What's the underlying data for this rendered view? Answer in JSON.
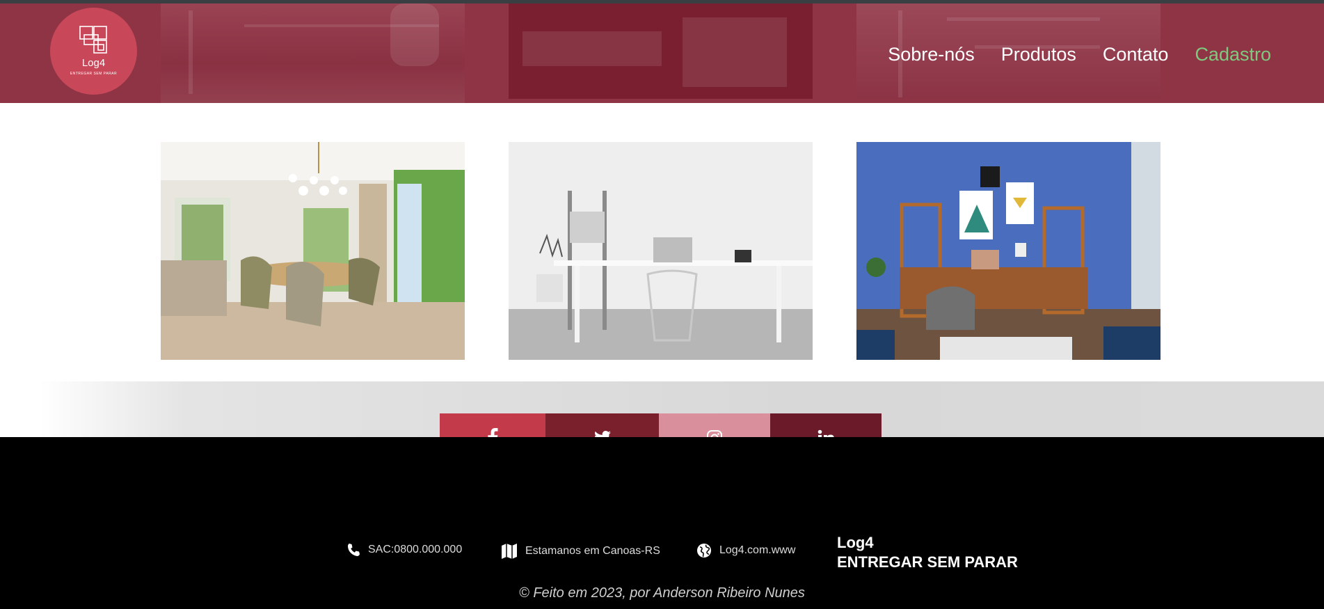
{
  "brand": {
    "name": "Log4",
    "tagline_small": "ENTREGAR SEM PARAR"
  },
  "nav": {
    "items": [
      {
        "label": "Sobre-nós"
      },
      {
        "label": "Produtos"
      },
      {
        "label": "Contato"
      },
      {
        "label": "Cadastro"
      }
    ]
  },
  "gallery": [
    {
      "icon": "dining-room-photo"
    },
    {
      "icon": "white-desk-photo"
    },
    {
      "icon": "blue-office-photo"
    }
  ],
  "social": [
    {
      "icon": "facebook-icon",
      "color": "#c33a4b"
    },
    {
      "icon": "twitter-icon",
      "color": "#7a1f2c"
    },
    {
      "icon": "instagram-icon",
      "color": "#d9909c"
    },
    {
      "icon": "linkedin-icon",
      "color": "#6a1a28"
    }
  ],
  "footer": {
    "phone": "SAC:0800.000.000",
    "location": "Estamanos em Canoas-RS",
    "website": "Log4.com.www",
    "brand_name": "Log4",
    "brand_tagline": "ENTREGAR SEM PARAR",
    "credit": "© Feito em 2023, por Anderson Ribeiro Nunes"
  },
  "colors": {
    "header_bg": "#8e3445",
    "logo_bg": "#c8485a",
    "nav_accent": "#7fc97f",
    "footer_bg": "#000000"
  }
}
